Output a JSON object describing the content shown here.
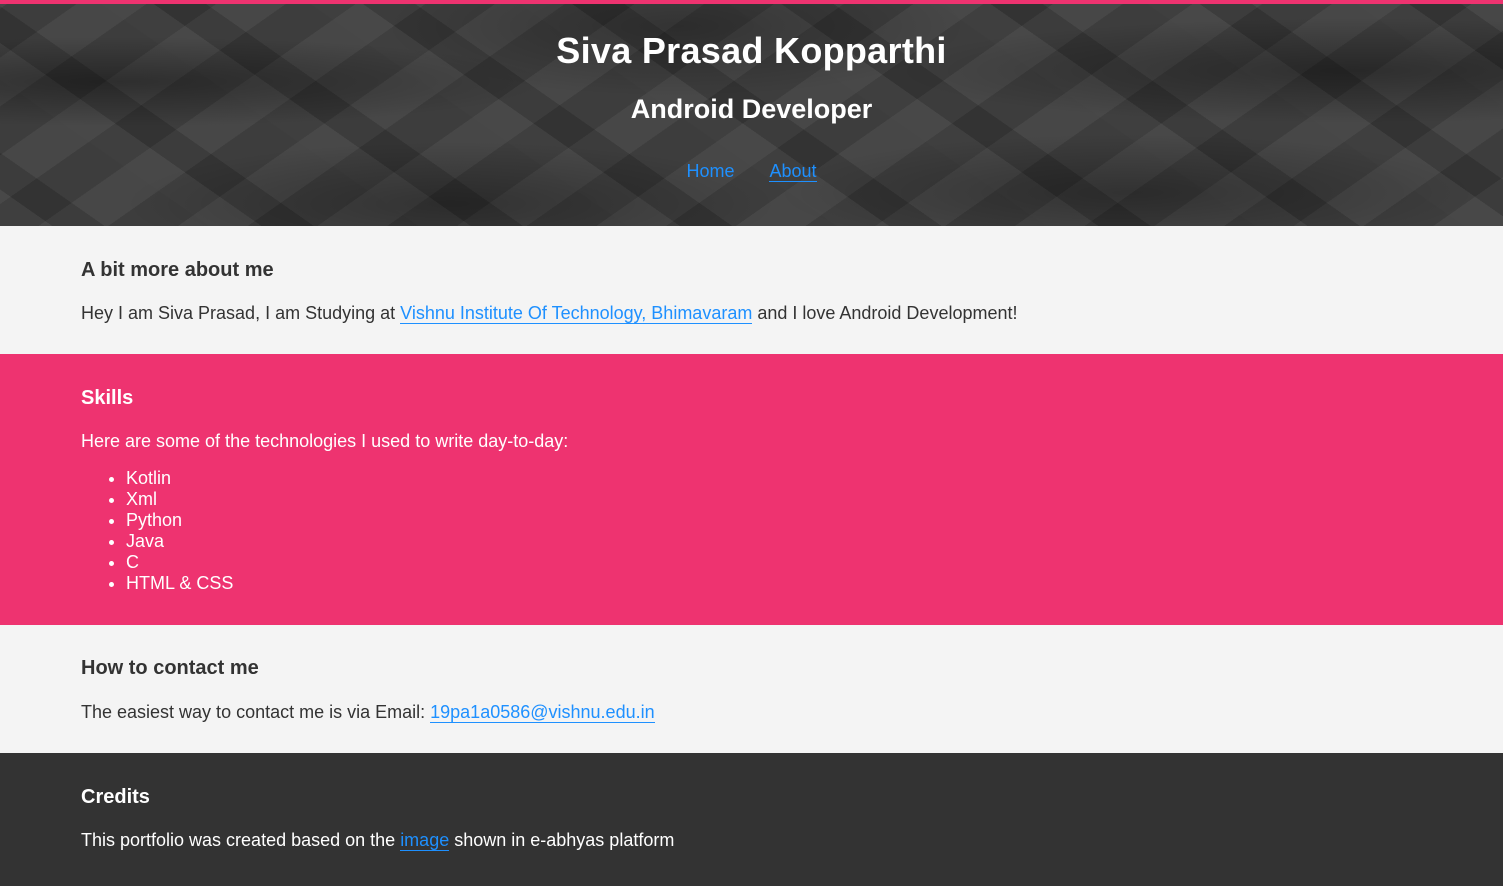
{
  "header": {
    "name": "Siva Prasad Kopparthi",
    "role": "Android Developer",
    "nav": [
      {
        "label": "Home"
      },
      {
        "label": "About"
      }
    ]
  },
  "about": {
    "heading": "A bit more about me",
    "text_before": "Hey I am Siva Prasad, I am Studying at ",
    "link": "Vishnu Institute Of Technology, Bhimavaram",
    "text_after": " and I love Android Development!"
  },
  "skills": {
    "heading": "Skills",
    "intro": "Here are some of the technologies I used to write day-to-day:",
    "items": [
      "Kotlin",
      "Xml",
      "Python",
      "Java",
      "C",
      "HTML & CSS"
    ]
  },
  "contact": {
    "heading": "How to contact me",
    "text": "The easiest way to contact me is via Email: ",
    "email": "19pa1a0586@vishnu.edu.in"
  },
  "credits": {
    "heading": "Credits",
    "text_before": "This portfolio was created based on the ",
    "link": "image",
    "text_after": " shown in e-abhyas platform"
  },
  "colors": {
    "accent": "#ee3370",
    "link": "#1e90ff",
    "header_bg": "#3b3b3b",
    "footer_bg": "#333333",
    "page_bg": "#f4f4f4"
  }
}
